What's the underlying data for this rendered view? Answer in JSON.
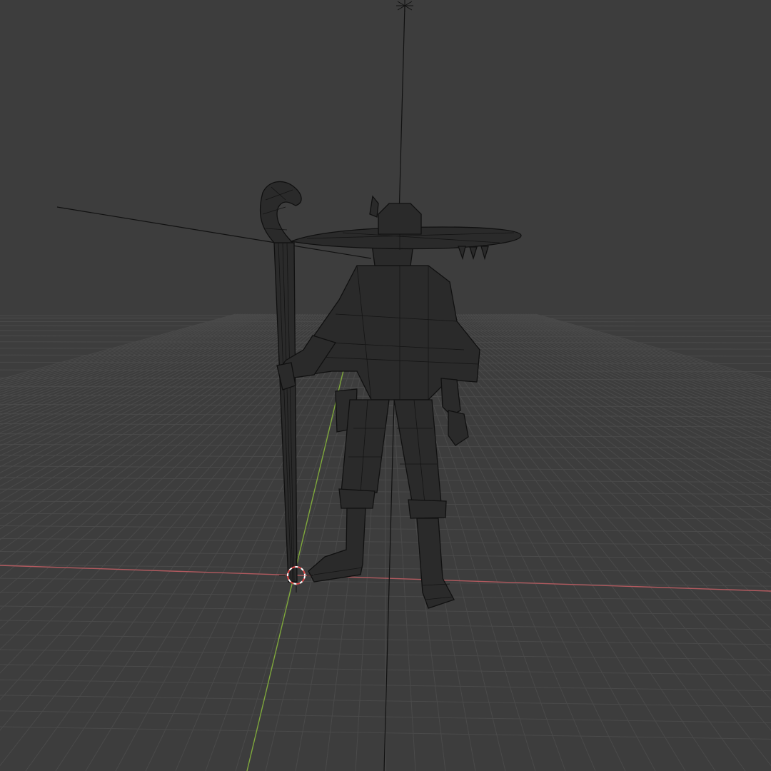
{
  "viewport": {
    "mode": "wireframe",
    "shading": "wireframe",
    "colors": {
      "background": "#3d3d3d",
      "grid_line": "#4a4a4a",
      "x_axis": "#b25a5f",
      "y_axis": "#7fa83c",
      "wireframe": "#111111",
      "cursor_red": "#e04848",
      "cursor_white": "#ffffff"
    }
  },
  "scene": {
    "objects": [
      "character-mesh",
      "staff-mesh",
      "wide-brim-hat",
      "light-object",
      "camera-object"
    ],
    "cursor_icon": "3d-cursor-icon",
    "light_icon": "light-icon"
  }
}
